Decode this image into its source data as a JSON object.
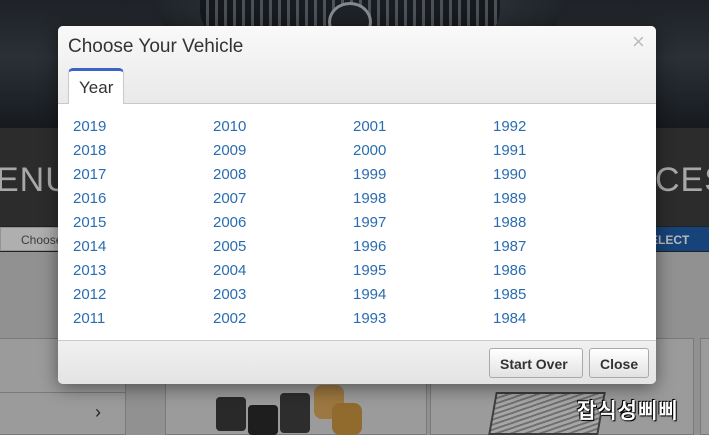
{
  "background": {
    "band_left_text": "ENU",
    "band_right_text": "CES",
    "choose_text": "Choose",
    "select_button": "ELECT",
    "chevron": "›",
    "watermark": "잡식성삐삐"
  },
  "modal": {
    "title": "Choose Your Vehicle",
    "close_symbol": "×",
    "tab_label": "Year",
    "year_columns": [
      [
        "2019",
        "2018",
        "2017",
        "2016",
        "2015",
        "2014",
        "2013",
        "2012",
        "2011"
      ],
      [
        "2010",
        "2009",
        "2008",
        "2007",
        "2006",
        "2005",
        "2004",
        "2003",
        "2002"
      ],
      [
        "2001",
        "2000",
        "1999",
        "1998",
        "1997",
        "1996",
        "1995",
        "1994",
        "1993"
      ],
      [
        "1992",
        "1991",
        "1990",
        "1989",
        "1988",
        "1987",
        "1986",
        "1985",
        "1984"
      ]
    ],
    "start_over_label": "Start Over",
    "close_label": "Close"
  },
  "colors": {
    "link": "#2a6cb0",
    "tab_accent": "#3b64c8"
  }
}
